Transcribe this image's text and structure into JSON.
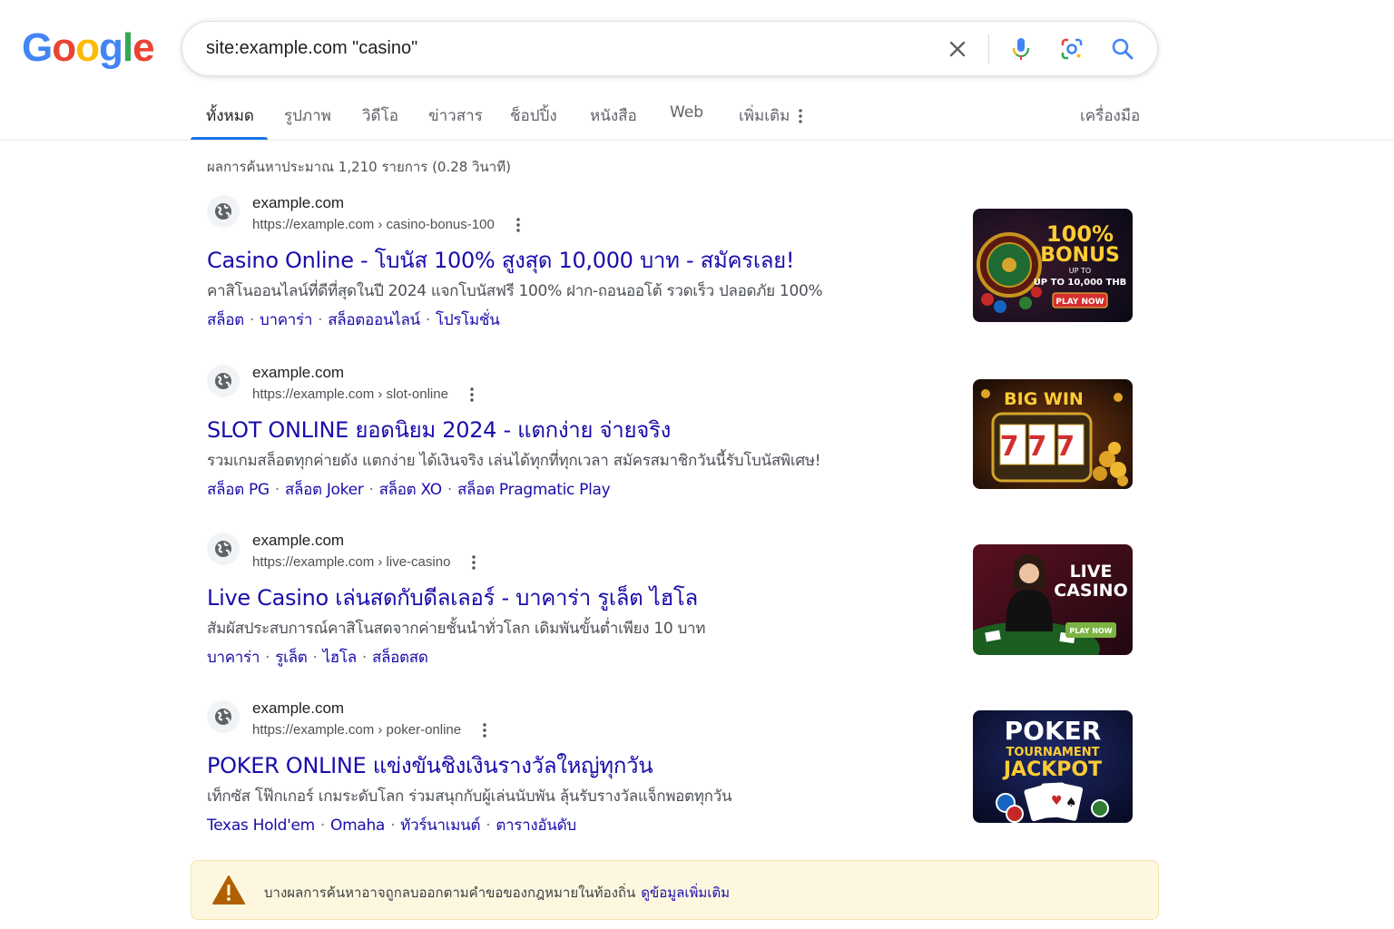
{
  "logo": {
    "letters": [
      "G",
      "o",
      "o",
      "g",
      "l",
      "e"
    ],
    "colors": [
      "#4285F4",
      "#EA4335",
      "#FBBC05",
      "#4285F4",
      "#34A853",
      "#EA4335"
    ]
  },
  "search": {
    "query": "site:example.com \"casino\""
  },
  "icons": {
    "clear": "close-icon",
    "voice": "microphone-icon",
    "lens": "lens-icon",
    "search": "search-icon"
  },
  "tabs": [
    {
      "label": "ทั้งหมด",
      "active": true
    },
    {
      "label": "รูปภาพ"
    },
    {
      "label": "วิดีโอ"
    },
    {
      "label": "ข่าวสาร"
    },
    {
      "label": "ช็อปปิ้ง"
    },
    {
      "label": "หนังสือ"
    },
    {
      "label": "Web"
    },
    {
      "label": "เพิ่มเติม"
    }
  ],
  "tools_label": "เครื่องมือ",
  "stats": "ผลการค้นหาประมาณ 1,210 รายการ (0.28 วินาที)",
  "results": [
    {
      "site": "example.com",
      "url": "https://example.com › casino-bonus-100",
      "title": "Casino Online - โบนัส 100% สูงสุด 10,000 บาท - สมัครเลย!",
      "snippet": "คาสิโนออนไลน์ที่ดีที่สุดในปี 2024 แจกโบนัสฟรี 100% ฝาก-ถอนออโต้ รวดเร็ว ปลอดภัย 100%",
      "sitelinks": [
        "สล็อต",
        "บาคาร่า",
        "สล็อตออนไลน์",
        "โปรโมชั่น"
      ],
      "thumb": {
        "line1": "100%",
        "line2": "BONUS",
        "line3": "UP TO",
        "line4": "UP TO 10,000 THB",
        "button": "PLAY NOW"
      }
    },
    {
      "site": "example.com",
      "url": "https://example.com › slot-online",
      "title": "SLOT ONLINE ยอดนิยม 2024 - แตกง่าย จ่ายจริง",
      "snippet": "รวมเกมสล็อตทุกค่ายดัง แตกง่าย ได้เงินจริง เล่นได้ทุกที่ทุกเวลา สมัครสมาชิกวันนี้รับโบนัสพิเศษ!",
      "sitelinks": [
        "สล็อต PG",
        "สล็อต Joker",
        "สล็อต XO",
        "สล็อต Pragmatic Play"
      ],
      "thumb": {
        "line1": "BIG WIN",
        "reels": "777"
      }
    },
    {
      "site": "example.com",
      "url": "https://example.com › live-casino",
      "title": "Live Casino เล่นสดกับดีลเลอร์ - บาคาร่า รูเล็ต ไฮโล",
      "snippet": "สัมผัสประสบการณ์คาสิโนสดจากค่ายชั้นนำทั่วโลก เดิมพันขั้นต่ำเพียง 10 บาท",
      "sitelinks": [
        "บาคาร่า",
        "รูเล็ต",
        "ไฮโล",
        "สล็อตสด"
      ],
      "thumb": {
        "line1": "LIVE",
        "line2": "CASINO",
        "button": "PLAY NOW"
      }
    },
    {
      "site": "example.com",
      "url": "https://example.com › poker-online",
      "title": "POKER ONLINE แข่งขันชิงเงินรางวัลใหญ่ทุกวัน",
      "snippet": "เท็กซัส โฟ๊กเกอร์ เกมระดับโลก ร่วมสนุกกับผู้เล่นนับพัน ลุ้นรับรางวัลแจ็กพอตทุกวัน",
      "sitelinks": [
        "Texas Hold'em",
        "Omaha",
        "ทัวร์นาเมนต์",
        "ตารางอันดับ"
      ],
      "thumb": {
        "line1": "POKER",
        "line2": "TOURNAMENT",
        "line3": "JACKPOT"
      }
    }
  ],
  "notice": {
    "text": "บางผลการค้นหาอาจถูกลบออกตามคำขอของกฎหมายในท้องถิ่น",
    "link": "ดูข้อมูลเพิ่มเติม"
  }
}
